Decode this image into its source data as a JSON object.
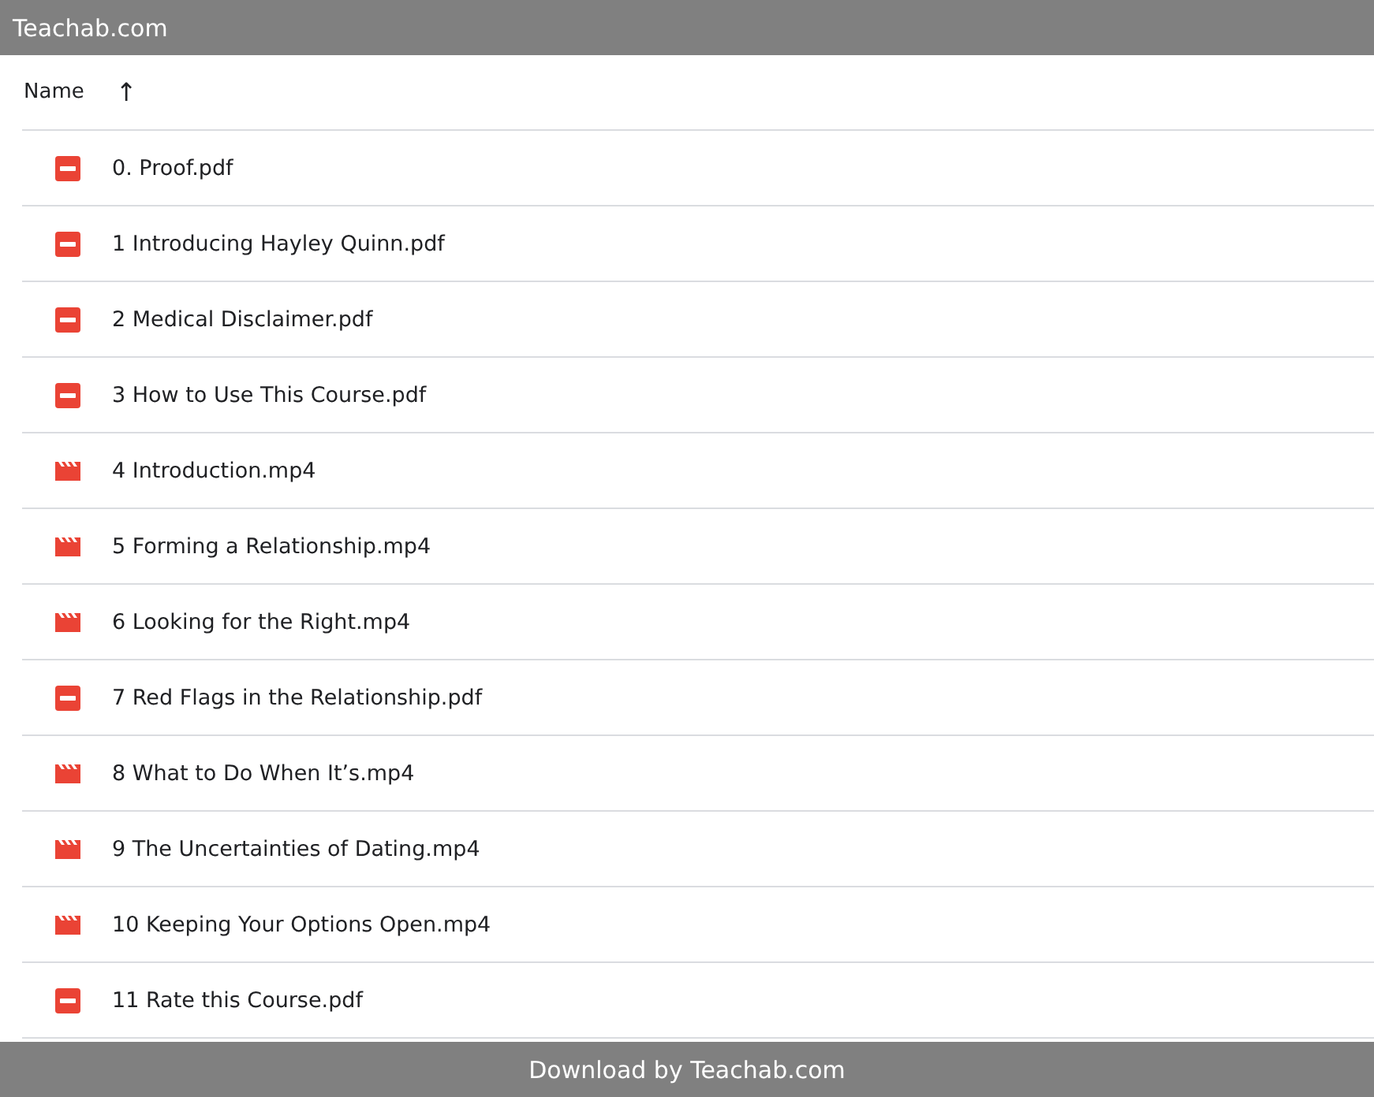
{
  "header": {
    "title": "Teachab.com"
  },
  "table": {
    "columns": [
      {
        "label": "Name",
        "sort_arrow": "↑"
      }
    ],
    "rows": [
      {
        "kind": "pdf",
        "name": "0. Proof.pdf"
      },
      {
        "kind": "pdf",
        "name": "1 Introducing Hayley Quinn.pdf"
      },
      {
        "kind": "pdf",
        "name": "2 Medical Disclaimer.pdf"
      },
      {
        "kind": "pdf",
        "name": "3 How to Use This Course.pdf"
      },
      {
        "kind": "video",
        "name": "4 Introduction.mp4"
      },
      {
        "kind": "video",
        "name": "5 Forming a Relationship.mp4"
      },
      {
        "kind": "video",
        "name": "6 Looking for the Right.mp4"
      },
      {
        "kind": "pdf",
        "name": "7 Red Flags in the Relationship.pdf"
      },
      {
        "kind": "video",
        "name": "8 What to Do When It’s.mp4"
      },
      {
        "kind": "video",
        "name": "9 The Uncertainties of Dating.mp4"
      },
      {
        "kind": "video",
        "name": "10 Keeping Your Options Open.mp4"
      },
      {
        "kind": "pdf",
        "name": "11 Rate this Course.pdf"
      }
    ]
  },
  "footer": {
    "text": "Download by Teachab.com"
  }
}
